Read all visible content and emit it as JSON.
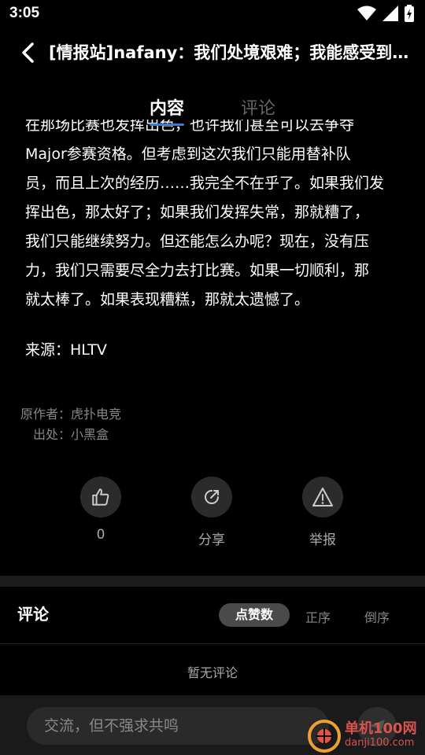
{
  "status": {
    "time": "3:05"
  },
  "header": {
    "title": "[情报站]nafany：我们处境艰难；我能感受到…"
  },
  "tabs": [
    {
      "label": "内容"
    },
    {
      "label": "评论"
    }
  ],
  "article": {
    "paragraphs": [
      "在那场比赛也发挥出色，也许我们甚至可以去争夺",
      "Major参赛资格。但考虑到这次我们只能用替补队",
      "员，而且上次的经历……我完全不在乎了。如果我们发",
      "挥出色，那太好了；如果我们发挥失常，那就糟了，",
      "我们只能继续努力。但还能怎么办呢？现在，没有压",
      "力，我们只需要尽全力去打比赛。如果一切顺利，那",
      "就太棒了。如果表现糟糕，那就太遗憾了。"
    ],
    "source": "来源：HLTV"
  },
  "meta": {
    "author": "原作者：虎扑电竞",
    "origin": "出处：小黑盒"
  },
  "actions": {
    "like_count": "0",
    "share_label": "分享",
    "report_label": "举报"
  },
  "comments": {
    "heading": "评论",
    "sort_options": [
      "点赞数",
      "正序",
      "倒序"
    ],
    "empty_text": "暂无评论",
    "input_placeholder": "交流，但不强求共鸣"
  },
  "watermark": {
    "line1": "单机100网",
    "line2": "danji100.com"
  },
  "colors": {
    "accent": "#3a7bd5",
    "background": "#000000",
    "watermark": "#d9534f"
  }
}
